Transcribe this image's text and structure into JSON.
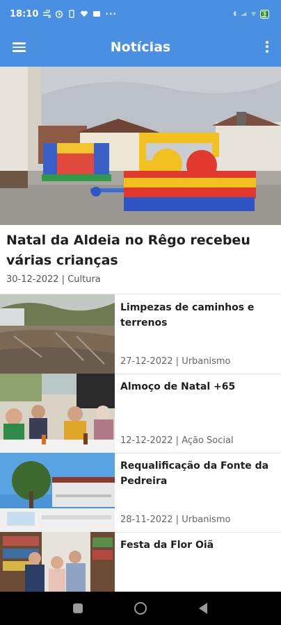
{
  "status_bar": {
    "time": "18:10",
    "icons": [
      "wind-icon",
      "clock-icon",
      "sim-icon",
      "heart-icon",
      "message-icon",
      "more-dots-icon"
    ],
    "right_icons": [
      "bluetooth-icon",
      "signal-icon",
      "wifi-icon"
    ],
    "battery": "63",
    "battery_level": 0.63
  },
  "app_bar": {
    "title": "Notícias"
  },
  "featured": {
    "title": "Natal da Aldeia no Rêgo recebeu várias crianças",
    "meta": "30-12-2022 | Cultura"
  },
  "news": [
    {
      "title": "Limpezas de caminhos e terrenos",
      "meta": "27-12-2022 | Urbanismo"
    },
    {
      "title": "Almoço de Natal +65",
      "meta": "12-12-2022 | Ação Social"
    },
    {
      "title": "Requalificação da Fonte da Pedreira",
      "meta": "28-11-2022 | Urbanismo"
    },
    {
      "title": "Festa da Flor Oiã",
      "meta": ""
    }
  ],
  "colors": {
    "primary": "#4a90e2",
    "text": "#1f1f1f",
    "meta": "#666666"
  }
}
